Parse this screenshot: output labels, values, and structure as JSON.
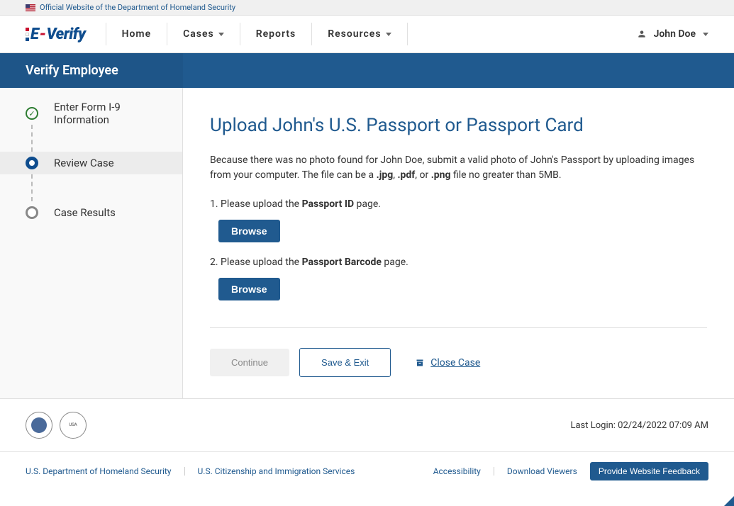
{
  "gov_banner": "Official Website of the Department of Homeland Security",
  "logo": {
    "e": "E",
    "dash": "-",
    "verify": "Verify"
  },
  "nav": {
    "home": "Home",
    "cases": "Cases",
    "reports": "Reports",
    "resources": "Resources"
  },
  "user": {
    "name": "John Doe"
  },
  "page_title": "Verify Employee",
  "steps": {
    "enter_form": "Enter Form I-9 Information",
    "review_case": "Review Case",
    "case_results": "Case Results"
  },
  "main": {
    "heading": "Upload John's U.S. Passport or Passport Card",
    "desc_part1": "Because there was no photo found for John Doe, submit a valid photo of John's Passport by uploading images from your computer. The file can be a ",
    "ext1": ".jpg",
    "desc_sep1": ", ",
    "ext2": ".pdf",
    "desc_sep2": ", or ",
    "ext3": ".png",
    "desc_part2": " file no greater than 5MB.",
    "upload1_pre": "1. Please upload the ",
    "upload1_bold": "Passport ID",
    "upload1_post": " page.",
    "upload2_pre": "2. Please upload the ",
    "upload2_bold": "Passport Barcode",
    "upload2_post": " page.",
    "browse": "Browse",
    "continue": "Continue",
    "save_exit": "Save & Exit",
    "close_case": "Close Case"
  },
  "footer": {
    "last_login": "Last Login: 02/24/2022 07:09 AM",
    "dhs": "U.S. Department of Homeland Security",
    "uscis": "U.S. Citizenship and Immigration Services",
    "accessibility": "Accessibility",
    "download_viewers": "Download Viewers",
    "feedback": "Provide Website Feedback"
  }
}
